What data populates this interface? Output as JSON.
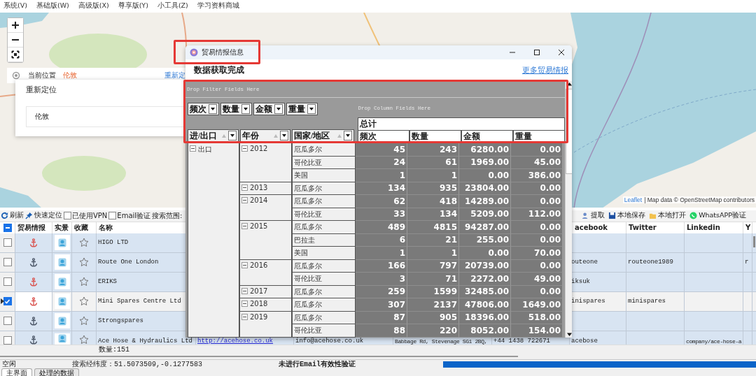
{
  "menu": [
    "系统(V)",
    "基础版(W)",
    "高级版(X)",
    "尊享版(Y)",
    "小工具(Z)",
    "学习资料商城"
  ],
  "map": {
    "location": {
      "label": "当前位置",
      "city": "伦敦",
      "relocate_link": "重新定"
    },
    "relocate_popup": {
      "title": "重新定位",
      "value": "伦敦"
    },
    "attribution": {
      "link": "Leaflet",
      "text": "| Map data © OpenStreetMap contributors"
    }
  },
  "toolbar_left": [
    {
      "kind": "button",
      "label": "刷新"
    },
    {
      "kind": "button",
      "label": "快速定位"
    },
    {
      "kind": "checkbox",
      "label": "已使用VPN",
      "checked": false
    },
    {
      "kind": "checkbox",
      "label": "Email验证",
      "checked": false
    },
    {
      "kind": "text",
      "label": "搜索范围:"
    }
  ],
  "toolbar_right": [
    "提取",
    "本地保存",
    "本地打开",
    "WhatsAPP验证"
  ],
  "grid": {
    "select_all_indeterminate": true,
    "columns": [
      "贸易情报",
      "实景",
      "收藏",
      "名称",
      "acebook",
      "Twitter",
      "Linkedin",
      "Y"
    ],
    "rows": [
      {
        "checked": false,
        "selected": false,
        "color": "#d9534f",
        "favorite": false,
        "name": "HIGO LTD"
      },
      {
        "checked": false,
        "selected": false,
        "color": "#4a5566",
        "favorite": false,
        "name": "Route One London",
        "facebook": "outeone",
        "twitter": "routeone1989",
        "column_13": "r"
      },
      {
        "checked": false,
        "selected": false,
        "color": "#d9534f",
        "favorite": false,
        "name": "ERIKS",
        "facebook": "iksuk"
      },
      {
        "checked": true,
        "selected": true,
        "color": "#d9534f",
        "favorite": false,
        "name": "Mini Spares Centre Ltd",
        "facebook": "inispares",
        "twitter": "minispares"
      },
      {
        "checked": false,
        "selected": false,
        "color": "#4a5566",
        "favorite": false,
        "name": "Strongspares"
      },
      {
        "checked": false,
        "selected": false,
        "color": "#4a5566",
        "favorite": false,
        "name": "Ace Hose & Hydraulics Ltd",
        "column_6": "http://acehose.co.uk",
        "column_7": "info@acehose.co.uk",
        "column_8": "Babbage Rd, Stevenage SG1 2BQ,",
        "column_9": "+44 1438 722671",
        "facebook": "acebose",
        "linkedin": "company/ace-hose-a"
      }
    ],
    "count": "数量:151"
  },
  "status_bar": {
    "state": "空闲",
    "coordinates": "搜索经纬度：51.5073509,-0.1277583",
    "email_status": "未进行Email有效性验证",
    "progress": {
      "level": 1
    }
  },
  "bottom_tabs": [
    {
      "label": "主界面",
      "selected": true
    },
    {
      "label": "处理的数据",
      "selected": false
    }
  ],
  "dialog": {
    "title": "贸易情报信息",
    "status": "数据获取完成",
    "more_link": "更多贸易情报",
    "pivot": {
      "filter_hint": "Drop Filter Fields Here",
      "column_hint": "Drop Column Fields Here",
      "data_fields": [
        "频次",
        "数量",
        "金额",
        "重量"
      ],
      "row_fields": [
        "进/出口",
        "年份",
        "国家/地区"
      ],
      "total_label": "总计",
      "measures": [
        "频次",
        "数量",
        "金额",
        "重量"
      ],
      "rows": [
        {
          "label": "出口",
          "expanded": true,
          "children": [
            {
              "label": "2012",
              "expanded": true,
              "children": [
                {
                  "label": "厄瓜多尔",
                  "values": [
                    "45",
                    "243",
                    "6280.00",
                    "0.00"
                  ]
                },
                {
                  "label": "哥伦比亚",
                  "values": [
                    "24",
                    "61",
                    "1969.00",
                    "45.00"
                  ]
                },
                {
                  "label": "美国",
                  "values": [
                    "1",
                    "1",
                    "0.00",
                    "386.00"
                  ]
                }
              ]
            },
            {
              "label": "2013",
              "expanded": true,
              "children": [
                {
                  "label": "厄瓜多尔",
                  "values": [
                    "134",
                    "935",
                    "23804.00",
                    "0.00"
                  ]
                }
              ]
            },
            {
              "label": "2014",
              "expanded": true,
              "children": [
                {
                  "label": "厄瓜多尔",
                  "values": [
                    "62",
                    "418",
                    "14289.00",
                    "0.00"
                  ]
                },
                {
                  "label": "哥伦比亚",
                  "values": [
                    "33",
                    "134",
                    "5209.00",
                    "112.00"
                  ]
                }
              ]
            },
            {
              "label": "2015",
              "expanded": true,
              "children": [
                {
                  "label": "厄瓜多尔",
                  "values": [
                    "489",
                    "4815",
                    "94287.00",
                    "0.00"
                  ]
                },
                {
                  "label": "巴拉圭",
                  "values": [
                    "6",
                    "21",
                    "255.00",
                    "0.00"
                  ]
                },
                {
                  "label": "美国",
                  "values": [
                    "1",
                    "1",
                    "0.00",
                    "70.00"
                  ]
                }
              ]
            },
            {
              "label": "2016",
              "expanded": true,
              "children": [
                {
                  "label": "厄瓜多尔",
                  "values": [
                    "166",
                    "797",
                    "20739.00",
                    "0.00"
                  ]
                },
                {
                  "label": "哥伦比亚",
                  "values": [
                    "3",
                    "71",
                    "2272.00",
                    "49.00"
                  ]
                }
              ]
            },
            {
              "label": "2017",
              "expanded": true,
              "children": [
                {
                  "label": "厄瓜多尔",
                  "values": [
                    "259",
                    "1599",
                    "32485.00",
                    "0.00"
                  ]
                }
              ]
            },
            {
              "label": "2018",
              "expanded": true,
              "children": [
                {
                  "label": "厄瓜多尔",
                  "values": [
                    "307",
                    "2137",
                    "47806.00",
                    "1649.00"
                  ]
                }
              ]
            },
            {
              "label": "2019",
              "expanded": true,
              "children": [
                {
                  "label": "厄瓜多尔",
                  "values": [
                    "87",
                    "905",
                    "18396.00",
                    "518.00"
                  ]
                },
                {
                  "label": "哥伦比亚",
                  "values": [
                    "88",
                    "220",
                    "8052.00",
                    "154.00"
                  ]
                }
              ]
            }
          ]
        }
      ]
    }
  }
}
